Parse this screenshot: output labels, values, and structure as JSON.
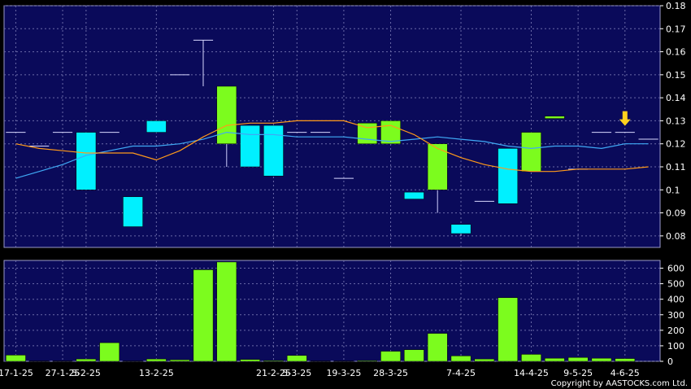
{
  "chart_data": {
    "type": "candlestick",
    "colors": {
      "background": "#000000",
      "plot_bg": "#0a0a5a",
      "grid": "#6a6aa8",
      "up": "#7cfc1e",
      "down": "#00f0ff",
      "ma_short": "#3fa9f5",
      "ma_long": "#ff9a1a",
      "marker": "#ffd21e",
      "text": "#ffffff"
    },
    "price_panel": {
      "ylim": [
        0.075,
        0.18
      ],
      "yticks": [
        0.08,
        0.09,
        0.1,
        0.11,
        0.12,
        0.13,
        0.14,
        0.15,
        0.16,
        0.17,
        0.18
      ],
      "grid": true,
      "candles": [
        {
          "o": 0.125,
          "h": 0.125,
          "l": 0.125,
          "c": 0.125
        },
        {
          "o": 0.119,
          "h": 0.119,
          "l": 0.119,
          "c": 0.119
        },
        {
          "o": 0.125,
          "h": 0.125,
          "l": 0.125,
          "c": 0.125
        },
        {
          "o": 0.125,
          "h": 0.125,
          "l": 0.1,
          "c": 0.1
        },
        {
          "o": 0.125,
          "h": 0.125,
          "l": 0.125,
          "c": 0.125
        },
        {
          "o": 0.097,
          "h": 0.097,
          "l": 0.084,
          "c": 0.084
        },
        {
          "o": 0.13,
          "h": 0.13,
          "l": 0.125,
          "c": 0.125
        },
        {
          "o": 0.15,
          "h": 0.15,
          "l": 0.15,
          "c": 0.15
        },
        {
          "o": 0.165,
          "h": 0.165,
          "l": 0.145,
          "c": 0.165
        },
        {
          "o": 0.12,
          "h": 0.145,
          "l": 0.11,
          "c": 0.145
        },
        {
          "o": 0.128,
          "h": 0.128,
          "l": 0.11,
          "c": 0.11
        },
        {
          "o": 0.128,
          "h": 0.128,
          "l": 0.106,
          "c": 0.106
        },
        {
          "o": 0.125,
          "h": 0.125,
          "l": 0.125,
          "c": 0.125
        },
        {
          "o": 0.125,
          "h": 0.125,
          "l": 0.125,
          "c": 0.125
        },
        {
          "o": 0.105,
          "h": 0.105,
          "l": 0.105,
          "c": 0.105
        },
        {
          "o": 0.12,
          "h": 0.129,
          "l": 0.12,
          "c": 0.129
        },
        {
          "o": 0.12,
          "h": 0.13,
          "l": 0.12,
          "c": 0.13
        },
        {
          "o": 0.099,
          "h": 0.099,
          "l": 0.096,
          "c": 0.096
        },
        {
          "o": 0.1,
          "h": 0.12,
          "l": 0.09,
          "c": 0.12
        },
        {
          "o": 0.085,
          "h": 0.085,
          "l": 0.08,
          "c": 0.081
        },
        {
          "o": 0.095,
          "h": 0.095,
          "l": 0.095,
          "c": 0.095
        },
        {
          "o": 0.118,
          "h": 0.118,
          "l": 0.094,
          "c": 0.094
        },
        {
          "o": 0.108,
          "h": 0.125,
          "l": 0.108,
          "c": 0.125
        },
        {
          "o": 0.131,
          "h": 0.132,
          "l": 0.131,
          "c": 0.132
        },
        {
          "o": 0.109,
          "h": 0.109,
          "l": 0.109,
          "c": 0.109
        },
        {
          "o": 0.125,
          "h": 0.125,
          "l": 0.125,
          "c": 0.125
        },
        {
          "o": 0.125,
          "h": 0.125,
          "l": 0.125,
          "c": 0.125
        },
        {
          "o": 0.122,
          "h": 0.122,
          "l": 0.122,
          "c": 0.122
        }
      ],
      "ma_short": [
        0.105,
        0.108,
        0.111,
        0.115,
        0.117,
        0.119,
        0.119,
        0.12,
        0.122,
        0.125,
        0.124,
        0.124,
        0.123,
        0.123,
        0.123,
        0.122,
        0.121,
        0.122,
        0.123,
        0.122,
        0.121,
        0.119,
        0.118,
        0.119,
        0.119,
        0.118,
        0.12,
        0.12
      ],
      "ma_long": [
        0.12,
        0.118,
        0.117,
        0.116,
        0.116,
        0.116,
        0.113,
        0.117,
        0.123,
        0.128,
        0.129,
        0.129,
        0.13,
        0.13,
        0.13,
        0.127,
        0.128,
        0.124,
        0.118,
        0.114,
        0.111,
        0.109,
        0.108,
        0.108,
        0.109,
        0.109,
        0.109,
        0.11
      ],
      "marker_index": 26
    },
    "volume_panel": {
      "ylim": [
        0,
        650
      ],
      "yticks": [
        0,
        100,
        200,
        300,
        400,
        500,
        600
      ],
      "grid": true,
      "volumes": [
        40,
        2,
        2,
        15,
        120,
        2,
        15,
        10,
        590,
        640,
        12,
        5,
        38,
        2,
        2,
        5,
        65,
        75,
        180,
        35,
        15,
        410,
        45,
        20,
        25,
        20,
        18,
        0
      ],
      "bar_color": "#7cfc1e"
    },
    "x_labels": [
      {
        "index": 0,
        "label": "17-1-25"
      },
      {
        "index": 2,
        "label": "27-1-25"
      },
      {
        "index": 3,
        "label": "5-2-25"
      },
      {
        "index": 6,
        "label": "13-2-25"
      },
      {
        "index": 11,
        "label": "21-2-25"
      },
      {
        "index": 12,
        "label": "5-3-25"
      },
      {
        "index": 14,
        "label": "19-3-25"
      },
      {
        "index": 16,
        "label": "28-3-25"
      },
      {
        "index": 19,
        "label": "7-4-25"
      },
      {
        "index": 22,
        "label": "14-4-25"
      },
      {
        "index": 24,
        "label": "9-5-25"
      },
      {
        "index": 26,
        "label": "4-6-25"
      }
    ]
  },
  "footer": {
    "copyright": "Copyright by AASTOCKS.com Ltd."
  }
}
